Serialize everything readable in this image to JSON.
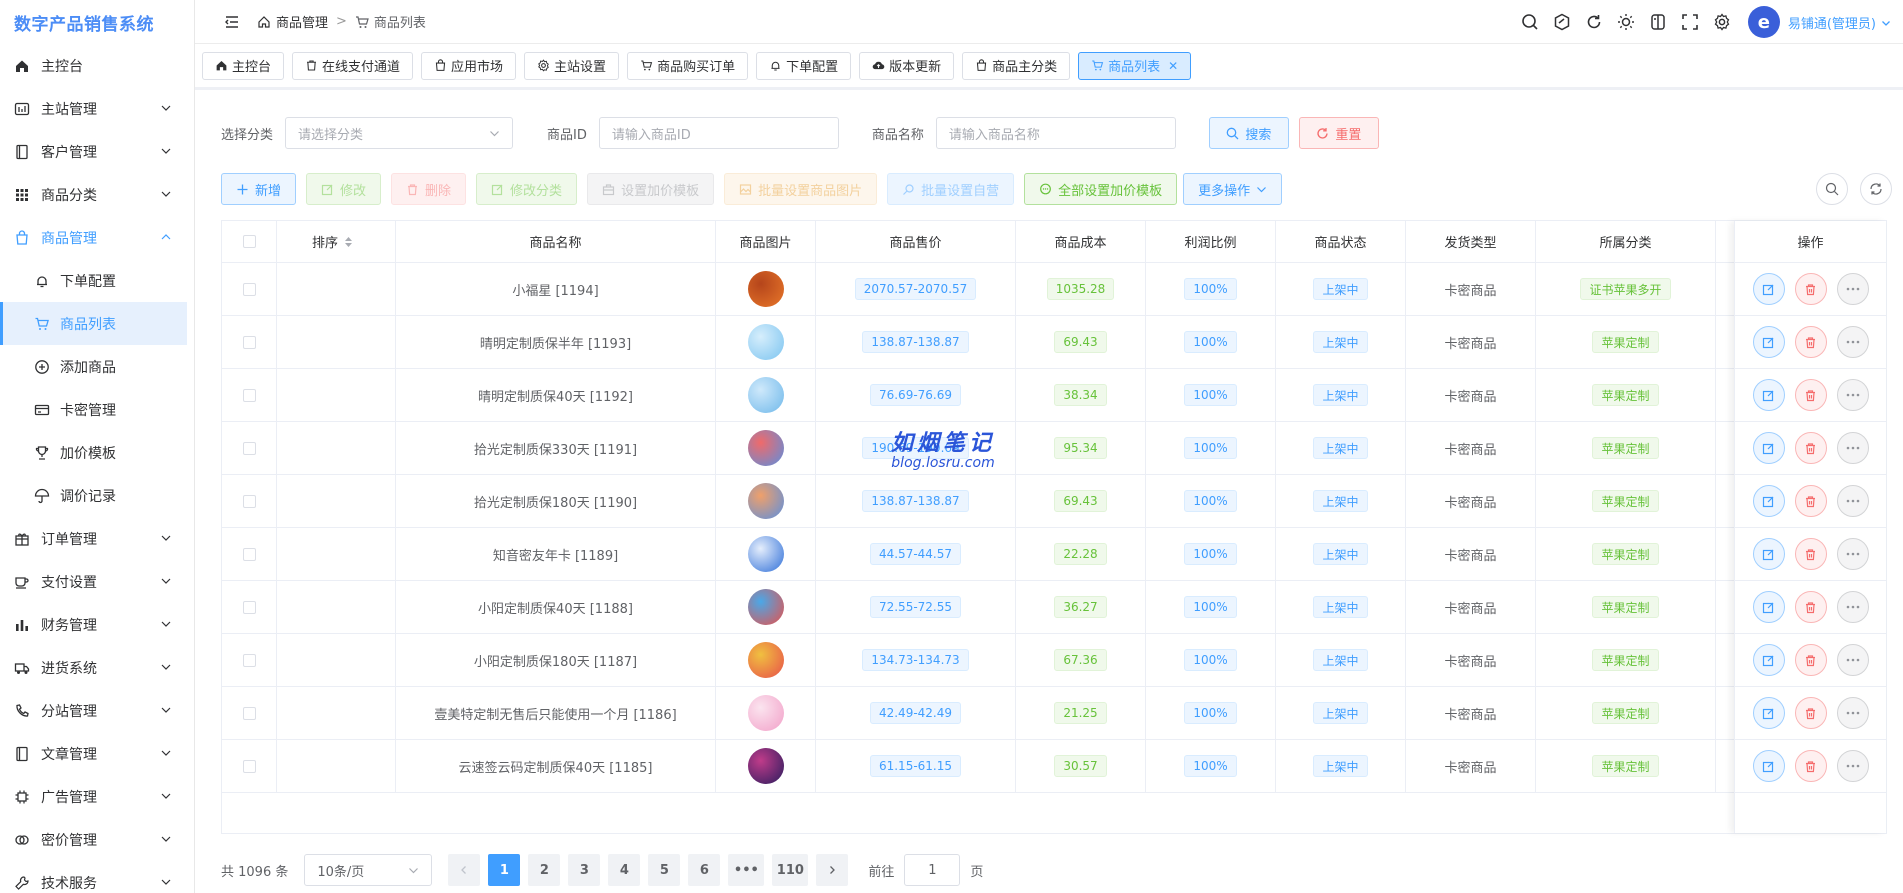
{
  "app": {
    "title": "数字产品销售系统",
    "user": "易铺通(管理员)",
    "avatar_text": "e",
    "colors": {
      "primary": "#409eff",
      "danger": "#f56c6c",
      "success": "#67c23a"
    }
  },
  "sidebar": {
    "items": [
      {
        "label": "主控台",
        "icon": "home-icon",
        "chevron": false
      },
      {
        "label": "主站管理",
        "icon": "dashboard-icon",
        "chevron": true
      },
      {
        "label": "客户管理",
        "icon": "book-icon",
        "chevron": true
      },
      {
        "label": "商品分类",
        "icon": "grid-icon",
        "chevron": true
      },
      {
        "label": "商品管理",
        "icon": "bag-icon",
        "chevron": true,
        "open": true
      },
      {
        "label": "订单管理",
        "icon": "gift-icon",
        "chevron": true
      },
      {
        "label": "支付设置",
        "icon": "cup-icon",
        "chevron": true
      },
      {
        "label": "财务管理",
        "icon": "bar-chart-icon",
        "chevron": true
      },
      {
        "label": "进货系统",
        "icon": "truck-icon",
        "chevron": true
      },
      {
        "label": "分站管理",
        "icon": "phone-icon",
        "chevron": true
      },
      {
        "label": "文章管理",
        "icon": "notebook-icon",
        "chevron": true
      },
      {
        "label": "广告管理",
        "icon": "chip-icon",
        "chevron": true
      },
      {
        "label": "密价管理",
        "icon": "link-icon",
        "chevron": true
      },
      {
        "label": "技术服务",
        "icon": "tool-icon",
        "chevron": true
      }
    ],
    "subitems": [
      {
        "label": "下单配置",
        "icon": "bell-icon"
      },
      {
        "label": "商品列表",
        "icon": "cart-icon",
        "active": true
      },
      {
        "label": "添加商品",
        "icon": "plus-circle-icon"
      },
      {
        "label": "卡密管理",
        "icon": "card-icon"
      },
      {
        "label": "加价模板",
        "icon": "trophy-icon"
      },
      {
        "label": "调价记录",
        "icon": "umbrella-icon"
      }
    ]
  },
  "breadcrumb": {
    "parent": "商品管理",
    "current": "商品列表"
  },
  "tabs": [
    {
      "label": "主控台",
      "icon": "home-icon"
    },
    {
      "label": "在线支付通道",
      "icon": "trash-icon"
    },
    {
      "label": "应用市场",
      "icon": "bag-icon"
    },
    {
      "label": "主站设置",
      "icon": "gear-icon"
    },
    {
      "label": "商品购买订单",
      "icon": "cart-icon"
    },
    {
      "label": "下单配置",
      "icon": "bell-icon"
    },
    {
      "label": "版本更新",
      "icon": "cloud-upload-icon"
    },
    {
      "label": "商品主分类",
      "icon": "bag-icon"
    },
    {
      "label": "商品列表",
      "icon": "cart-icon",
      "active": true
    }
  ],
  "filters": {
    "category_label": "选择分类",
    "category_placeholder": "请选择分类",
    "id_label": "商品ID",
    "id_placeholder": "请输入商品ID",
    "name_label": "商品名称",
    "name_placeholder": "请输入商品名称",
    "search": "搜索",
    "reset": "重置"
  },
  "actions": {
    "add": "新增",
    "edit": "修改",
    "delete": "删除",
    "edit_category": "修改分类",
    "set_template": "设置加价模板",
    "batch_image": "批量设置商品图片",
    "batch_self": "批量设置自营",
    "all_template": "全部设置加价模板",
    "more": "更多操作"
  },
  "table": {
    "headers": {
      "sort": "排序",
      "name": "商品名称",
      "image": "商品图片",
      "price": "商品售价",
      "cost": "商品成本",
      "profit": "利润比例",
      "status": "商品状态",
      "delivery": "发货类型",
      "category": "所属分类",
      "ops": "操作"
    },
    "rows": [
      {
        "name": "小福星 [1194]",
        "price": "2070.57-2070.57",
        "cost": "1035.28",
        "profit": "100%",
        "status": "上架中",
        "delivery": "卡密商品",
        "category": "证书苹果多开",
        "img": [
          "#e8772a",
          "#b5451b"
        ]
      },
      {
        "name": "晴明定制质保半年 [1193]",
        "price": "138.87-138.87",
        "cost": "69.43",
        "profit": "100%",
        "status": "上架中",
        "delivery": "卡密商品",
        "category": "苹果定制",
        "img": [
          "#7cc4f0",
          "#d6eefc"
        ]
      },
      {
        "name": "晴明定制质保40天 [1192]",
        "price": "76.69-76.69",
        "cost": "38.34",
        "profit": "100%",
        "status": "上架中",
        "delivery": "卡密商品",
        "category": "苹果定制",
        "img": [
          "#6fb8ea",
          "#cfe9fb"
        ]
      },
      {
        "name": "拾光定制质保330天 [1191]",
        "price": "190.69-190.69",
        "cost": "95.34",
        "profit": "100%",
        "status": "上架中",
        "delivery": "卡密商品",
        "category": "苹果定制",
        "img": [
          "#5a8fe0",
          "#f06a6a"
        ]
      },
      {
        "name": "拾光定制质保180天 [1190]",
        "price": "138.87-138.87",
        "cost": "69.43",
        "profit": "100%",
        "status": "上架中",
        "delivery": "卡密商品",
        "category": "苹果定制",
        "img": [
          "#5a8fe0",
          "#f0a06a"
        ]
      },
      {
        "name": "知音密友年卡 [1189]",
        "price": "44.57-44.57",
        "cost": "22.28",
        "profit": "100%",
        "status": "上架中",
        "delivery": "卡密商品",
        "category": "苹果定制",
        "img": [
          "#2f6fd8",
          "#e5eefc"
        ]
      },
      {
        "name": "小阳定制质保40天 [1188]",
        "price": "72.55-72.55",
        "cost": "36.27",
        "profit": "100%",
        "status": "上架中",
        "delivery": "卡密商品",
        "category": "苹果定制",
        "img": [
          "#e8504a",
          "#4aa8e8"
        ]
      },
      {
        "name": "小阳定制质保180天 [1187]",
        "price": "134.73-134.73",
        "cost": "67.36",
        "profit": "100%",
        "status": "上架中",
        "delivery": "卡密商品",
        "category": "苹果定制",
        "img": [
          "#e8504a",
          "#f0c040"
        ]
      },
      {
        "name": "壹美特定制无售后只能使用一个月 [1186]",
        "price": "42.49-42.49",
        "cost": "21.25",
        "profit": "100%",
        "status": "上架中",
        "delivery": "卡密商品",
        "category": "苹果定制",
        "img": [
          "#f2a0c8",
          "#fbe4ef"
        ]
      },
      {
        "name": "云速签云码定制质保40天 [1185]",
        "price": "61.15-61.15",
        "cost": "30.57",
        "profit": "100%",
        "status": "上架中",
        "delivery": "卡密商品",
        "category": "苹果定制",
        "img": [
          "#2a1c5e",
          "#c03c8a"
        ]
      }
    ]
  },
  "pager": {
    "total": "共 1096 条",
    "page_size": "10条/页",
    "pages": [
      "1",
      "2",
      "3",
      "4",
      "5",
      "6",
      "•••",
      "110"
    ],
    "goto_label": "前往",
    "goto_value": "1",
    "page_unit": "页"
  },
  "watermark": {
    "title": "如烟笔记",
    "url": "blog.losru.com"
  }
}
